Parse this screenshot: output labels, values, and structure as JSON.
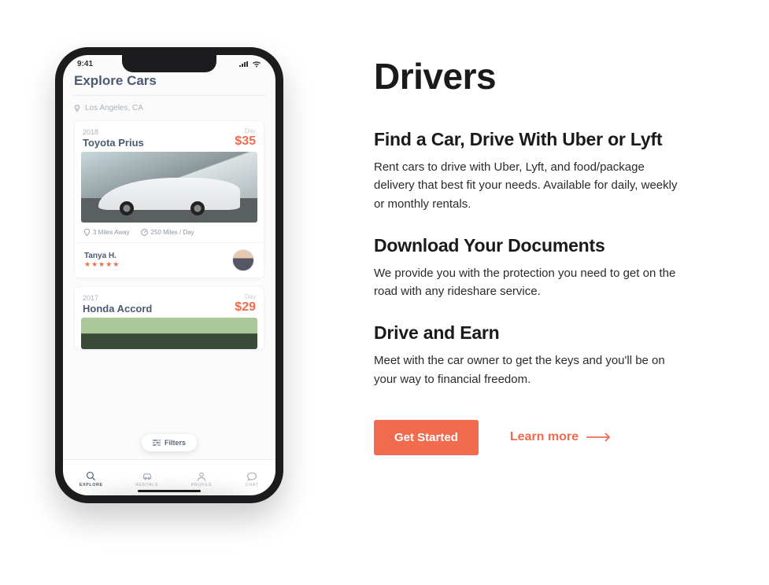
{
  "phone": {
    "status_time": "9:41",
    "title": "Explore Cars",
    "location": "Los Angeles, CA",
    "filters_label": "Filters",
    "card1": {
      "year": "2018",
      "model": "Toyota Prius",
      "day_label": "Day",
      "price": "$35",
      "distance": "3 Miles Away",
      "allowance": "250 Miles / Day",
      "owner": "Tanya H.",
      "stars": "★★★★★"
    },
    "card2": {
      "year": "2017",
      "model": "Honda Accord",
      "day_label": "Day",
      "price": "$29"
    },
    "tabs": {
      "0": "Explore",
      "1": "Rentals",
      "2": "Profile",
      "3": "Chat"
    }
  },
  "content": {
    "heading": "Drivers",
    "sections": {
      "0": {
        "title": "Find a Car, Drive With Uber or Lyft",
        "body": "Rent cars to drive with Uber, Lyft, and food/package delivery that best fit your needs. Available for daily, weekly or monthly rentals."
      },
      "1": {
        "title": "Download Your Documents",
        "body": "We provide you with the protection you need to get on the road with any rideshare service."
      },
      "2": {
        "title": "Drive and Earn",
        "body": "Meet with the car owner to get the keys and you'll be on your way to financial freedom."
      }
    },
    "cta": "Get Started",
    "learn": "Learn more"
  }
}
